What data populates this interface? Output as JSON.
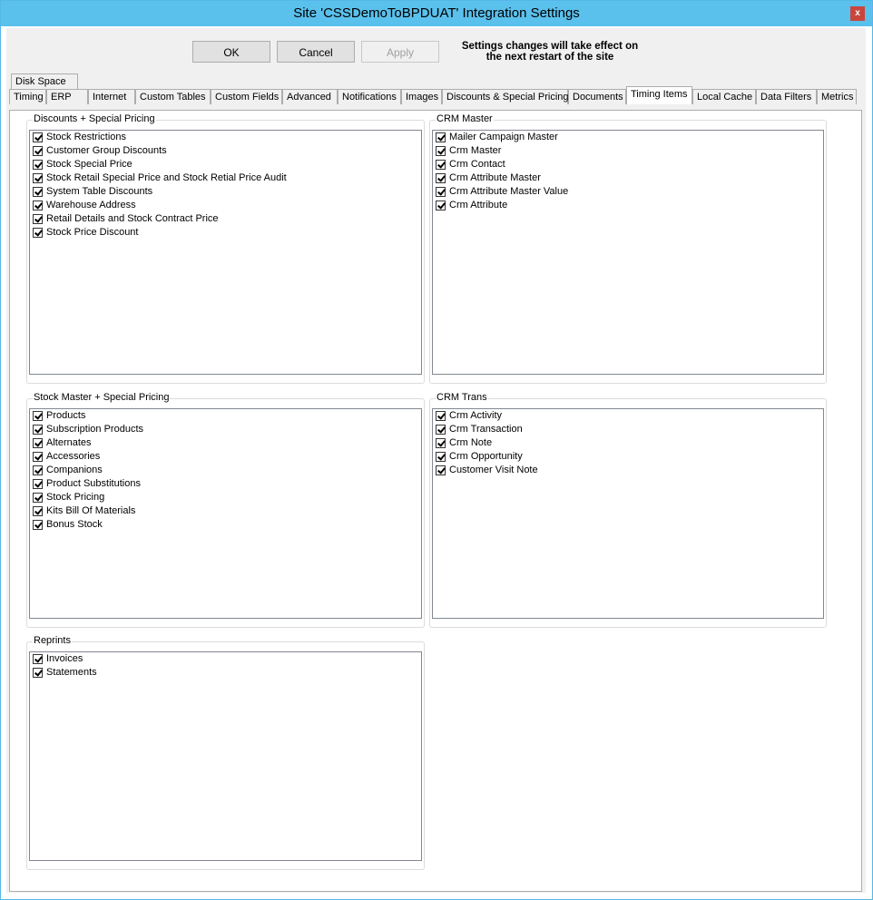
{
  "window": {
    "title": "Site 'CSSDemoToBPDUAT' Integration Settings",
    "close_label": "x"
  },
  "buttons": {
    "ok": "OK",
    "cancel": "Cancel",
    "apply": "Apply"
  },
  "notice": {
    "line1": "Settings changes will take effect on",
    "line2": "the next restart of the site"
  },
  "tabs_top": [
    "Disk Space"
  ],
  "tabs": [
    "Timing",
    "ERP",
    "Internet",
    "Custom Tables",
    "Custom Fields",
    "Advanced",
    "Notifications",
    "Images",
    "Discounts & Special Pricing",
    "Documents",
    "Timing Items",
    "Local Cache",
    "Data Filters",
    "Metrics"
  ],
  "active_tab": "Timing Items",
  "groups": {
    "discounts": {
      "title": "Discounts + Special Pricing",
      "items": [
        "Stock Restrictions",
        "Customer Group Discounts",
        "Stock Special Price",
        "Stock Retail Special Price and Stock Retial Price Audit",
        "System Table Discounts",
        "Warehouse Address",
        "Retail Details and Stock Contract Price",
        "Stock Price Discount"
      ]
    },
    "crm_master": {
      "title": "CRM Master",
      "items": [
        "Mailer Campaign Master",
        "Crm Master",
        "Crm Contact",
        "Crm Attribute Master",
        "Crm Attribute Master Value",
        "Crm Attribute"
      ]
    },
    "stock_master": {
      "title": "Stock Master + Special Pricing",
      "items": [
        "Products",
        "Subscription Products",
        "Alternates",
        "Accessories",
        "Companions",
        "Product Substitutions",
        "Stock Pricing",
        "Kits Bill Of Materials",
        "Bonus Stock"
      ]
    },
    "crm_trans": {
      "title": "CRM Trans",
      "items": [
        "Crm Activity",
        "Crm Transaction",
        "Crm Note",
        "Crm Opportunity",
        "Customer Visit Note"
      ]
    },
    "reprints": {
      "title": "Reprints",
      "items": [
        "Invoices",
        "Statements"
      ]
    }
  }
}
